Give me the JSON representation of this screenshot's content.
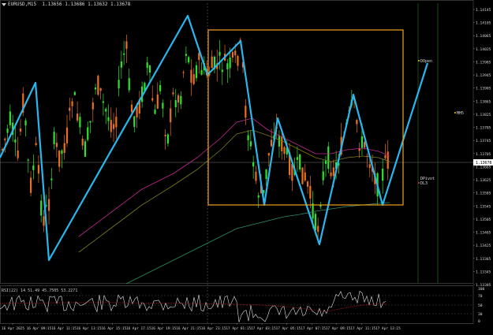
{
  "window": {
    "symbol_label": "EURUSD,M15",
    "ohlc_text": "1.13656 1.13686 1.13632 1.13678"
  },
  "indicator": {
    "label": "RSI(22) 14 51.49 45.7505 53.2271"
  },
  "price_axis": {
    "labels": [
      "1.14145",
      "1.14105",
      "1.14065",
      "1.14025",
      "1.13985",
      "1.13945",
      "1.13905",
      "1.13865",
      "1.13825",
      "1.13785",
      "1.13745",
      "1.13705",
      "1.13665",
      "1.13625",
      "1.13585",
      "1.13545",
      "1.13505",
      "1.13465",
      "1.13425",
      "1.13385",
      "1.13345",
      "1.13305"
    ],
    "current_price": "1.13678"
  },
  "sub_axis": {
    "labels": [
      "100",
      "70",
      "50",
      "30",
      "0"
    ]
  },
  "time_axis": {
    "labels": [
      "16 Apr 2025",
      "16 Apr 09:15",
      "16 Apr 11:15",
      "16 Apr 13:15",
      "16 Apr 15:15",
      "16 Apr 17:15",
      "16 Apr 19:15",
      "16 Apr 21:15",
      "16 Apr 23:15",
      "17 Apr 01:15",
      "17 Apr 03:15",
      "17 Apr 05:15",
      "17 Apr 07:15",
      "17 Apr 09:15",
      "17 Apr 11:15",
      "17 Apr 13:15"
    ]
  },
  "annotations": {
    "dopen": "DOpen",
    "mh5": "MH5",
    "dpivot": "DPivot",
    "dl3": "DL3"
  },
  "colors": {
    "bull": "#2ee32e",
    "bear": "#e8701e",
    "zigzag": "#2ab6ee",
    "box": "#f0a020",
    "ma_pink": "#c02890",
    "ma_olive": "#807b18",
    "ma_green": "#2e8f62",
    "grid": "#2a2a2a",
    "axis_text": "#d8d8d8"
  }
}
